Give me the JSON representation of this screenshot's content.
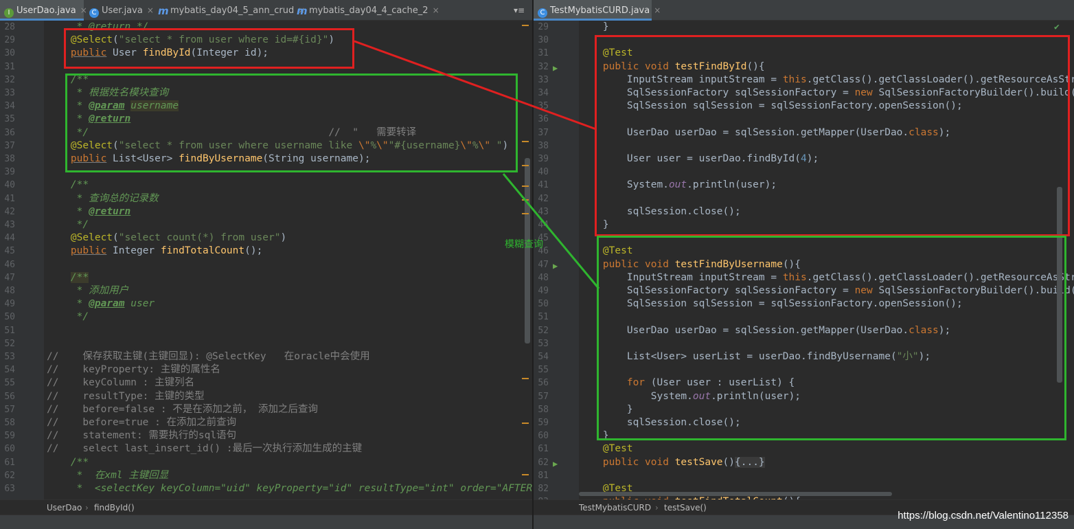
{
  "left_tabs": [
    {
      "label": "UserDao.java",
      "icon": "interface-icon",
      "active": true
    },
    {
      "label": "User.java",
      "icon": "class-icon",
      "active": false
    },
    {
      "label": "mybatis_day04_5_ann_crud",
      "icon": "module-icon",
      "active": false
    },
    {
      "label": "mybatis_day04_4_cache_2",
      "icon": "module-icon",
      "active": false
    }
  ],
  "left_tab_menu": "▾≡",
  "right_tabs": [
    {
      "label": "TestMybatisCURD.java",
      "icon": "class-icon",
      "active": true
    }
  ],
  "close_glyph": "×",
  "left_breadcrumb": {
    "items": [
      "UserDao",
      "findById()"
    ],
    "sep": "›"
  },
  "right_breadcrumb": {
    "items": [
      "TestMybatisCURD",
      "testSave()"
    ],
    "sep": "›"
  },
  "annotation_label": "模糊查询",
  "watermark": "https://blog.csdn.net/Valentino112358",
  "left_code": [
    {
      "n": "28",
      "html": "     <span class='dc'>* @return */</span>"
    },
    {
      "n": "29",
      "html": "    <span class='an'>@Select</span>(<span class='str'>\"select * from user where id=#{id}\"</span>)"
    },
    {
      "n": "30",
      "html": "    <span class='kw und'>public</span> User <span class='fn'>findById</span>(Integer id);"
    },
    {
      "n": "31",
      "html": ""
    },
    {
      "n": "32",
      "html": "    <span class='dc'>/**</span>"
    },
    {
      "n": "33",
      "html": "     <span class='dc'>* 根据姓名模块查询</span>"
    },
    {
      "n": "34",
      "html": "     <span class='dc'>* </span><span class='dtag'>@param</span><span class='dc'> </span><span class='dc hl'>username</span>"
    },
    {
      "n": "35",
      "html": "     <span class='dc'>* </span><span class='dtag'>@return</span>"
    },
    {
      "n": "36",
      "html": "     <span class='dc'>*/</span>                                        <span class='cm'>//  \"   需要转译</span>"
    },
    {
      "n": "37",
      "html": "    <span class='an'>@Select</span>(<span class='str'>\"select * from user where username like </span><span class='kw'>\\\"</span><span class='str'>%</span><span class='kw'>\\\"</span><span class='str'>\"#{username}</span><span class='kw'>\\\"</span><span class='str'>%</span><span class='kw'>\\\"</span><span class='str'> \"</span>)"
    },
    {
      "n": "38",
      "html": "    <span class='kw und'>public</span> List&lt;User&gt; <span class='fn'>findByUsername</span>(String username);"
    },
    {
      "n": "39",
      "html": ""
    },
    {
      "n": "40",
      "html": "    <span class='dc'>/**</span>"
    },
    {
      "n": "41",
      "html": "     <span class='dc'>* 查询总的记录数</span>"
    },
    {
      "n": "42",
      "html": "     <span class='dc'>* </span><span class='dtag'>@return</span>"
    },
    {
      "n": "43",
      "html": "     <span class='dc'>*/</span>"
    },
    {
      "n": "44",
      "html": "    <span class='an'>@Select</span>(<span class='str'>\"select count(*) from user\"</span>)"
    },
    {
      "n": "45",
      "html": "    <span class='kw und'>public</span> Integer <span class='fn'>findTotalCount</span>();"
    },
    {
      "n": "46",
      "html": ""
    },
    {
      "n": "47",
      "html": "    <span class='dc hl'>/**</span>"
    },
    {
      "n": "48",
      "html": "     <span class='dc'>* 添加用户</span>"
    },
    {
      "n": "49",
      "html": "     <span class='dc'>* </span><span class='dtag'>@param</span><span class='dc'> user</span>"
    },
    {
      "n": "50",
      "html": "     <span class='dc'>*/</span>"
    },
    {
      "n": "51",
      "html": ""
    },
    {
      "n": "52",
      "html": ""
    },
    {
      "n": "53",
      "html": "<span class='cm'>//    保存获取主键(主键回显): @SelectKey   在oracle中会使用</span>"
    },
    {
      "n": "54",
      "html": "<span class='cm'>//    keyProperty: 主键的属性名</span>"
    },
    {
      "n": "55",
      "html": "<span class='cm'>//    keyColumn : 主键列名</span>"
    },
    {
      "n": "56",
      "html": "<span class='cm'>//    resultType: 主键的类型</span>"
    },
    {
      "n": "57",
      "html": "<span class='cm'>//    before=false : 不是在添加之前， 添加之后查询</span>"
    },
    {
      "n": "58",
      "html": "<span class='cm'>//    before=true : 在添加之前查询</span>"
    },
    {
      "n": "59",
      "html": "<span class='cm'>//    statement: 需要执行的sql语句</span>"
    },
    {
      "n": "60",
      "html": "<span class='cm'>//    select last_insert_id() :最后一次执行添加生成的主键</span>"
    },
    {
      "n": "61",
      "html": "    <span class='dc'>/**</span>"
    },
    {
      "n": "62",
      "html": "     <span class='dc'>*  在xml 主键回显</span>"
    },
    {
      "n": "63",
      "html": "     <span class='dc'>*  &lt;selectKey keyColumn=\"uid\" keyProperty=\"id\" resultType=\"int\" order=\"AFTER\"&gt;</span>"
    }
  ],
  "right_code": [
    {
      "n": "29",
      "html": "    }"
    },
    {
      "n": "30",
      "html": ""
    },
    {
      "n": "31",
      "html": "    <span class='an'>@Test</span>"
    },
    {
      "n": "32",
      "html": "    <span class='kw'>public void</span> <span class='fn'>testFindById</span>(){"
    },
    {
      "n": "33",
      "html": "        InputStream inputStream = <span class='kw'>this</span>.getClass().getClassLoader().getResourceAsStream(<span class='str'>\"SqlMapConfig.xml\"</span>);"
    },
    {
      "n": "34",
      "html": "        SqlSessionFactory sqlSessionFactory = <span class='kw'>new</span> SqlSessionFactoryBuilder().build(inputStream);"
    },
    {
      "n": "35",
      "html": "        SqlSession sqlSession = sqlSessionFactory.openSession();"
    },
    {
      "n": "36",
      "html": ""
    },
    {
      "n": "37",
      "html": "        UserDao userDao = sqlSession.getMapper(UserDao.<span class='kw'>class</span>);"
    },
    {
      "n": "38",
      "html": ""
    },
    {
      "n": "39",
      "html": "        User user = userDao.findById(<span class='num'>4</span>);"
    },
    {
      "n": "40",
      "html": ""
    },
    {
      "n": "41",
      "html": "        System.<span class='fld'>out</span>.println(user);"
    },
    {
      "n": "42",
      "html": ""
    },
    {
      "n": "43",
      "html": "        sqlSession.close();"
    },
    {
      "n": "44",
      "html": "    }"
    },
    {
      "n": "45",
      "html": ""
    },
    {
      "n": "46",
      "html": "    <span class='an'>@Test</span>"
    },
    {
      "n": "47",
      "html": "    <span class='kw'>public void</span> <span class='fn'>testFindByUsername</span>(){"
    },
    {
      "n": "48",
      "html": "        InputStream inputStream = <span class='kw'>this</span>.getClass().getClassLoader().getResourceAsStream(<span class='str'>\"SqlMapConfig.xml\"</span>);"
    },
    {
      "n": "49",
      "html": "        SqlSessionFactory sqlSessionFactory = <span class='kw'>new</span> SqlSessionFactoryBuilder().build(inputStream);"
    },
    {
      "n": "50",
      "html": "        SqlSession sqlSession = sqlSessionFactory.openSession();"
    },
    {
      "n": "51",
      "html": ""
    },
    {
      "n": "52",
      "html": "        UserDao userDao = sqlSession.getMapper(UserDao.<span class='kw'>class</span>);"
    },
    {
      "n": "53",
      "html": ""
    },
    {
      "n": "54",
      "html": "        List&lt;User&gt; userList = userDao.findByUsername(<span class='str'>\"小\"</span>);"
    },
    {
      "n": "55",
      "html": ""
    },
    {
      "n": "56",
      "html": "        <span class='kw'>for</span> (User user : userList) {"
    },
    {
      "n": "57",
      "html": "            System.<span class='fld'>out</span>.println(user);"
    },
    {
      "n": "58",
      "html": "        }"
    },
    {
      "n": "59",
      "html": "        sqlSession.close();"
    },
    {
      "n": "60",
      "html": "    }"
    },
    {
      "n": "61",
      "html": "    <span class='an'>@Test</span>"
    },
    {
      "n": "62",
      "html": "    <span class='kw'>public void</span> <span class='fn'>testSave</span>()<span style='background:#3a3a3a'>{...}</span>"
    },
    {
      "n": "81",
      "html": ""
    },
    {
      "n": "82",
      "html": "    <span class='an'>@Test</span>"
    },
    {
      "n": "83",
      "html": "    <span class='kw'>public void</span> <span class='fn'>testFindTotalCount</span>(){"
    }
  ],
  "right_run_icon_lines": [
    "32",
    "47",
    "62",
    "83"
  ],
  "right_status_check": "✔",
  "run_icon_glyph": "▶",
  "colors": {
    "red_box": "#e02020",
    "green_box": "#2fb52f"
  }
}
